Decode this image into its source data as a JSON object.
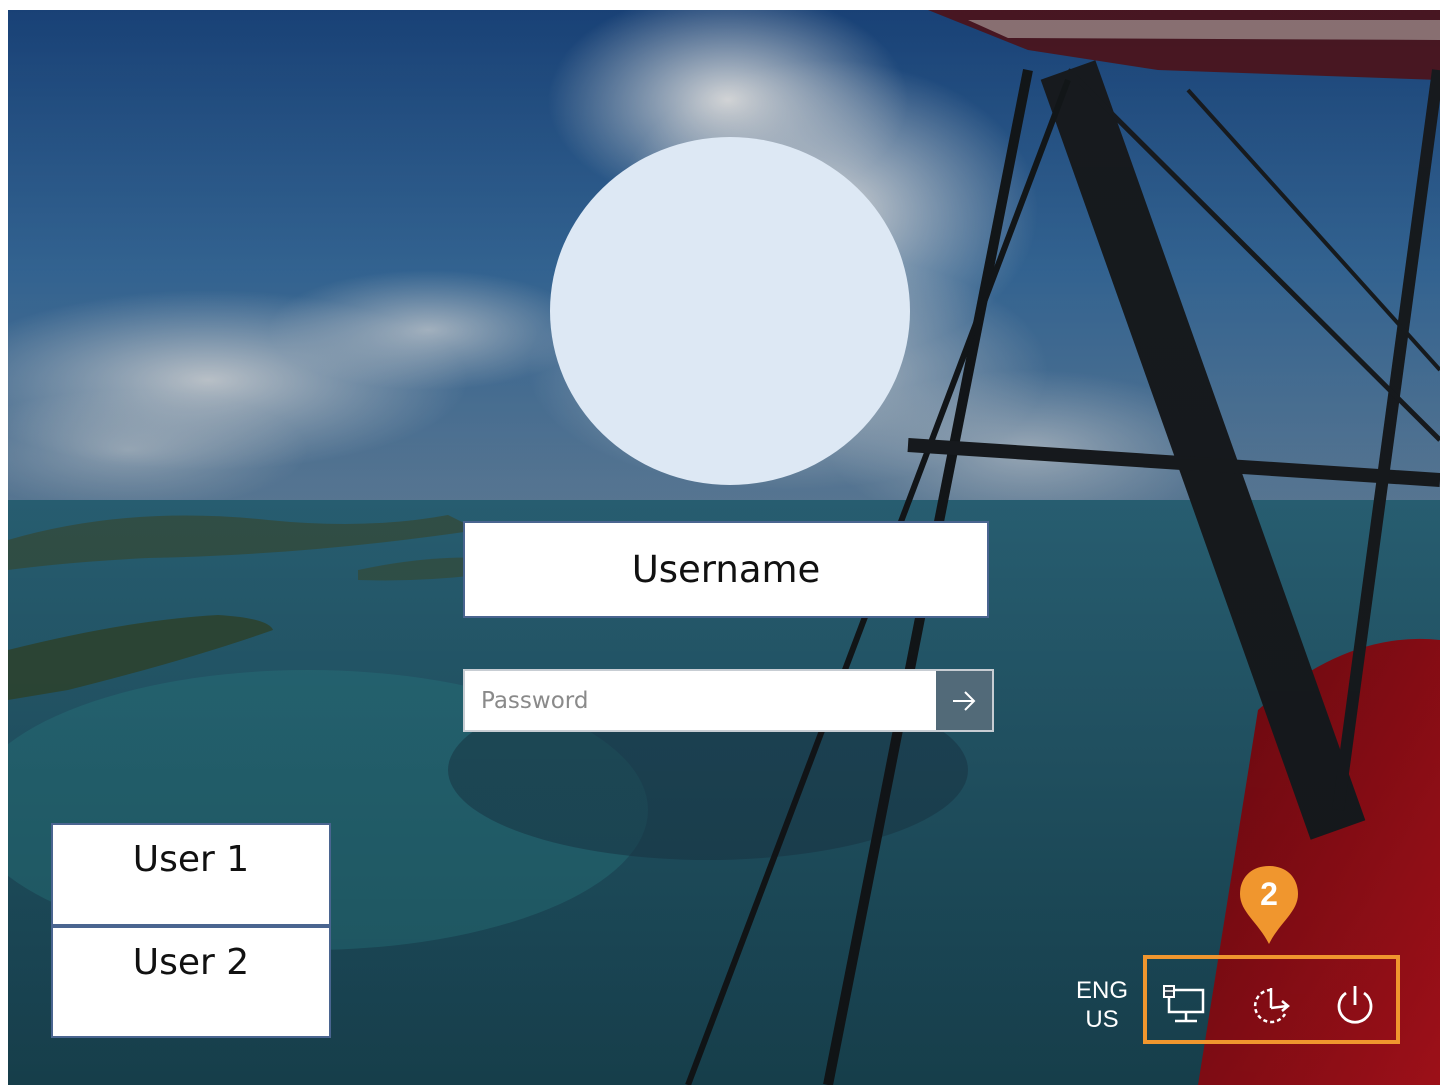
{
  "user_tile": {
    "username": "Username"
  },
  "password": {
    "placeholder": "Password",
    "submit_icon": "arrow-right-icon"
  },
  "user_list": [
    {
      "label": "User 1"
    },
    {
      "label": "User 2"
    }
  ],
  "language": {
    "line1": "ENG",
    "line2": "US"
  },
  "tray": {
    "network_icon": "network-icon",
    "ease_of_access_icon": "ease-of-access-icon",
    "power_icon": "power-icon"
  },
  "callout": {
    "number": "2",
    "color": "#f0962e"
  },
  "colors": {
    "avatar": "#dde8f4",
    "box_border": "#4a6590",
    "highlight": "#f0962e"
  }
}
